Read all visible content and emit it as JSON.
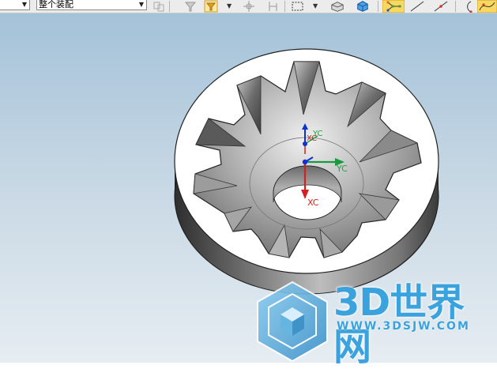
{
  "toolbar": {
    "selection_filter_value": "",
    "scope_value": "整个装配",
    "colors": {
      "accent": "#f0c020",
      "highlight": "#f8d860"
    }
  },
  "viewport": {
    "wcs_labels": {
      "y_top": "YC",
      "x_top": "XC",
      "y_center": "YC",
      "x_center": "XC"
    },
    "colors": {
      "x_axis": "#d42020",
      "y_axis": "#20a040",
      "z_axis": "#1030d0"
    }
  },
  "watermark": {
    "title": "3D世界网",
    "url": "WWW.3DSJW.COM",
    "color": "#3aa2dd"
  }
}
